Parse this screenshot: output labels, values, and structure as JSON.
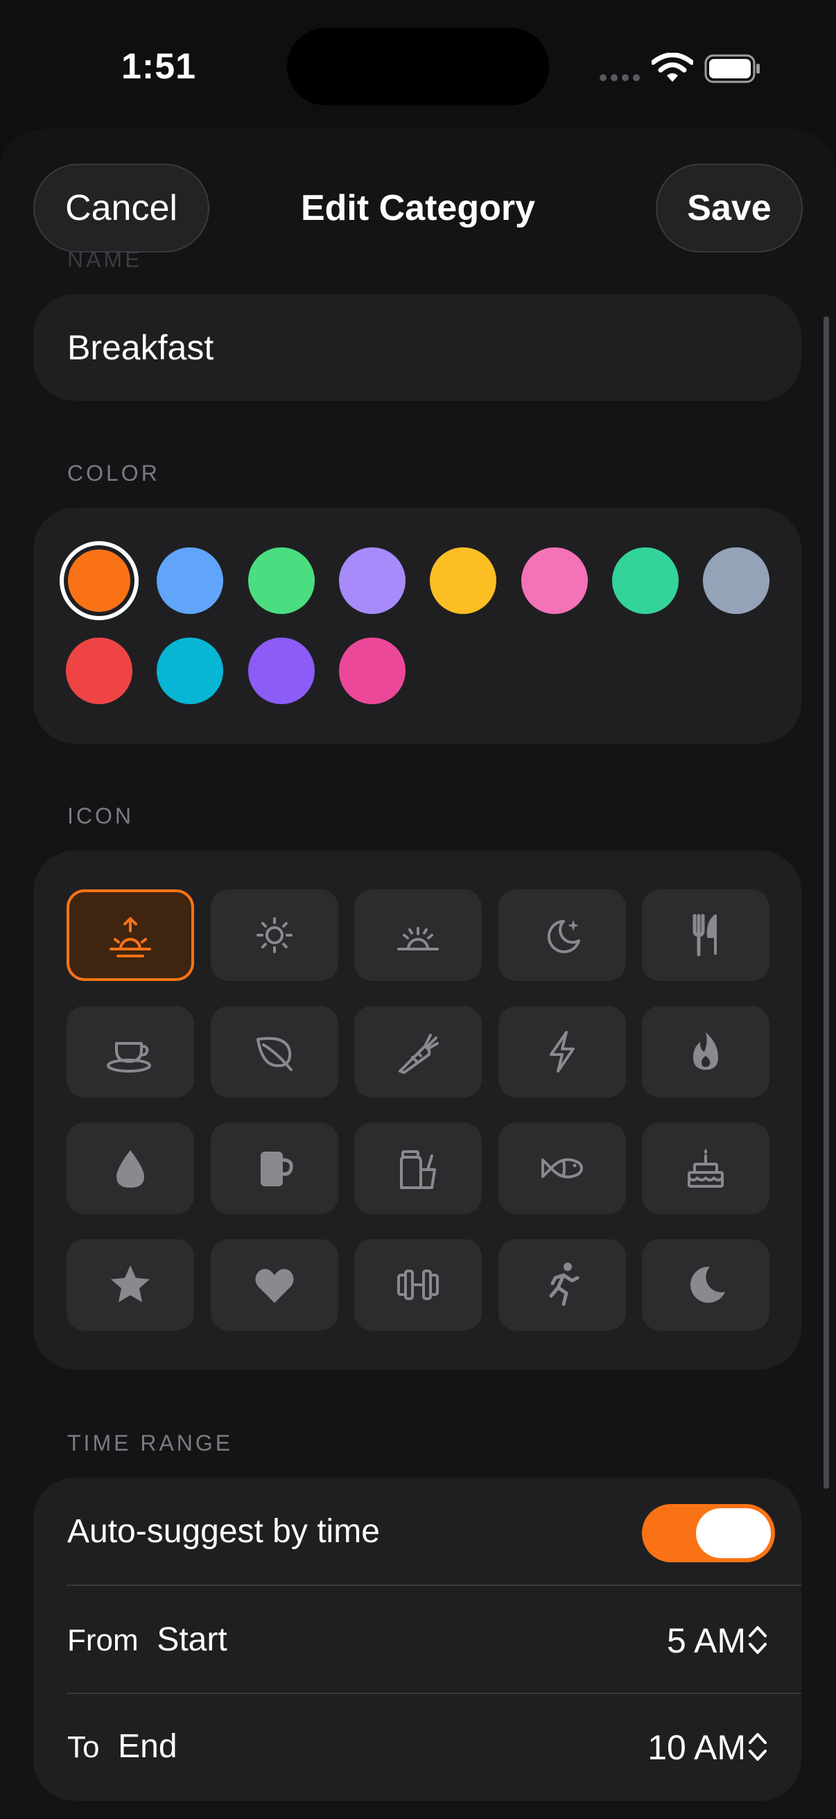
{
  "status_bar": {
    "time": "1:51"
  },
  "nav": {
    "cancel_label": "Cancel",
    "title": "Edit Category",
    "save_label": "Save"
  },
  "name_section": {
    "label": "NAME",
    "value": "Breakfast"
  },
  "color_section": {
    "label": "COLOR",
    "selected_index": 0,
    "colors": [
      "#f97316",
      "#60a5fa",
      "#4ade80",
      "#a78bfa",
      "#fbbf24",
      "#f472b6",
      "#34d399",
      "#94a3b8",
      "#ef4444",
      "#06b6d4",
      "#8b5cf6",
      "#ec4899"
    ]
  },
  "icon_section": {
    "label": "ICON",
    "selected_index": 0,
    "icons": [
      "sunrise-icon",
      "sun-icon",
      "sunset-icon",
      "moon-stars-icon",
      "fork-knife-icon",
      "cup-saucer-icon",
      "leaf-icon",
      "carrot-icon",
      "bolt-icon",
      "flame-icon",
      "drop-icon",
      "mug-icon",
      "jar-glass-icon",
      "fish-icon",
      "birthday-cake-icon",
      "star-icon",
      "heart-icon",
      "dumbbell-icon",
      "runner-icon",
      "moon-icon"
    ]
  },
  "time_range": {
    "label": "TIME RANGE",
    "auto_suggest_label": "Auto-suggest by time",
    "auto_suggest_on": true,
    "from_label": "From",
    "from_sub": "Start",
    "from_value": "5 AM",
    "to_label": "To",
    "to_sub": "End",
    "to_value": "10 AM"
  }
}
